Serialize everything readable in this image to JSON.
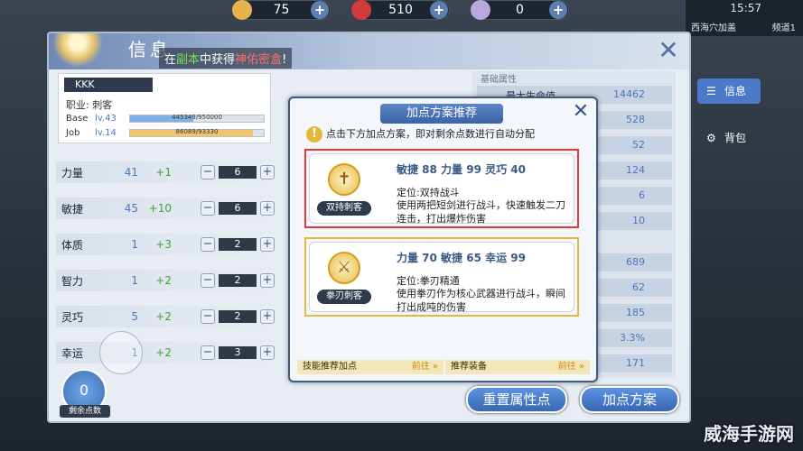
{
  "currencies": [
    {
      "icon": "coin-icon",
      "value": "75",
      "color": "#e8b24a"
    },
    {
      "icon": "gem-icon",
      "value": "510",
      "color": "#d13b3b"
    },
    {
      "icon": "card-icon",
      "value": "0",
      "color": "#b9a8d9"
    }
  ],
  "status": {
    "time": "15:57",
    "location": "西海穴加盖",
    "channel": "频道1"
  },
  "panel": {
    "title": "信息",
    "message_pre": "在",
    "message_green": "副本",
    "message_mid": "中获得",
    "message_red": "神佑密盒",
    "message_post": "!"
  },
  "character": {
    "name": "KKK",
    "job_label": "职业:",
    "job": "刺客",
    "base_label": "Base",
    "base_lv": "lv.43",
    "base_exp": "445349/950000",
    "base_ratio": 0.47,
    "job_label2": "Job",
    "job_lv": "lv.14",
    "job_exp": "86089/93330",
    "job_ratio": 0.92
  },
  "stats": [
    {
      "name": "力量",
      "value": "41",
      "bonus": "+1",
      "alloc": "6"
    },
    {
      "name": "敏捷",
      "value": "45",
      "bonus": "+10",
      "alloc": "6"
    },
    {
      "name": "体质",
      "value": "1",
      "bonus": "+3",
      "alloc": "2"
    },
    {
      "name": "智力",
      "value": "1",
      "bonus": "+2",
      "alloc": "2"
    },
    {
      "name": "灵巧",
      "value": "5",
      "bonus": "+2",
      "alloc": "2"
    },
    {
      "name": "幸运",
      "value": "1",
      "bonus": "+2",
      "alloc": "3"
    }
  ],
  "points": {
    "value": "0",
    "label": "剩余点数"
  },
  "right_list": {
    "header": "基础属性",
    "first_key": "最大生命值",
    "values": [
      "14462",
      "528",
      "52",
      "124",
      "6",
      "10",
      "689",
      "62",
      "185",
      "3.3%",
      "171"
    ]
  },
  "dialog": {
    "title": "加点方案推荐",
    "tip": "点击下方加点方案，即对剩余点数进行自动分配",
    "options": [
      {
        "badge": "双持刺客",
        "stats": "敏捷 88 力量 99 灵巧 40",
        "role": "定位:双持战斗",
        "desc": "使用两把短剑进行战斗，快速触发二刀连击，打出爆炸伤害"
      },
      {
        "badge": "拳刃刺客",
        "stats": "力量 70 敏捷 65 幸运 99",
        "role": "定位:拳刃精通",
        "desc": "使用拳刃作为核心武器进行战斗，瞬间打出成吨的伤害"
      }
    ],
    "footer_left": "技能推荐加点",
    "footer_right": "推荐装备",
    "go": "前往 »"
  },
  "buttons": {
    "reset": "重置属性点",
    "plan": "加点方案"
  },
  "side_tabs": {
    "info": "信息",
    "bag": "背包"
  },
  "watermark": "威海手游网"
}
